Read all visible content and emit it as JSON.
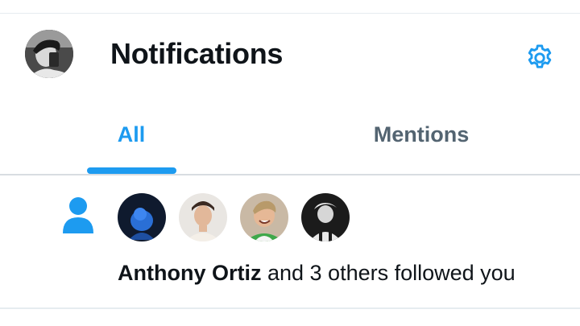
{
  "header": {
    "title": "Notifications",
    "settings_icon": "gear-icon"
  },
  "tabs": [
    {
      "label": "All",
      "active": true
    },
    {
      "label": "Mentions",
      "active": false
    }
  ],
  "notification": {
    "type_icon": "person-icon",
    "actor_name": "Anthony Ortiz",
    "message": " and 3 others followed you",
    "avatar_count": 4
  },
  "colors": {
    "accent": "#1d9bf0",
    "text": "#0f1419",
    "muted": "#536471"
  }
}
